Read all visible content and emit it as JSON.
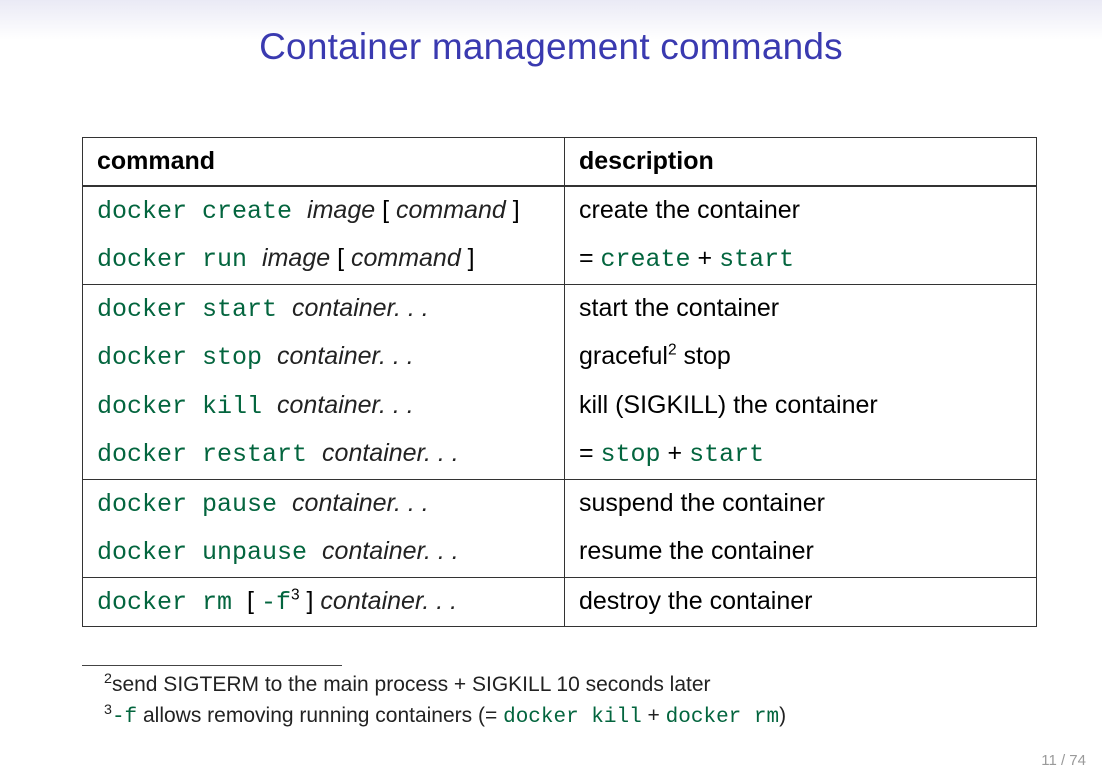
{
  "title": "Container management commands",
  "headers": {
    "col1": "command",
    "col2": "description"
  },
  "rows": [
    {
      "cmd": {
        "tt": "docker create ",
        "it": "image",
        "extra": " [ ",
        "it2": "command",
        "extra2": " ]"
      },
      "desc": {
        "plain": "create the container"
      },
      "topBorder": true,
      "botBorder": false
    },
    {
      "cmd": {
        "tt": "docker run ",
        "it": "image",
        "extra": " [ ",
        "it2": "command",
        "extra2": " ]"
      },
      "desc": {
        "eq": "=",
        "tt1": "create",
        "plus": "+",
        "tt2": "start"
      },
      "topBorder": false,
      "botBorder": true
    },
    {
      "cmd": {
        "tt": "docker start ",
        "it": "container. . ."
      },
      "desc": {
        "plain": "start the container"
      },
      "topBorder": true,
      "botBorder": false
    },
    {
      "cmd": {
        "tt": "docker stop ",
        "it": "container. . ."
      },
      "desc": {
        "plainPre": "graceful",
        "sup": "2",
        "plainPost": " stop"
      },
      "topBorder": false,
      "botBorder": false
    },
    {
      "cmd": {
        "tt": "docker kill ",
        "it": "container. . ."
      },
      "desc": {
        "plain": "kill (SIGKILL) the container"
      },
      "topBorder": false,
      "botBorder": false
    },
    {
      "cmd": {
        "tt": "docker restart ",
        "it": "container. . ."
      },
      "desc": {
        "eq": "=",
        "tt1": "stop",
        "plus": "+",
        "tt2": "start"
      },
      "topBorder": false,
      "botBorder": true
    },
    {
      "cmd": {
        "tt": "docker pause ",
        "it": "container. . ."
      },
      "desc": {
        "plain": "suspend the container"
      },
      "topBorder": true,
      "botBorder": false
    },
    {
      "cmd": {
        "tt": "docker unpause ",
        "it": "container. . ."
      },
      "desc": {
        "plain": "resume the container"
      },
      "topBorder": false,
      "botBorder": true
    },
    {
      "cmd": {
        "tt": "docker rm ",
        "extra": "[ ",
        "ttflag": "-f",
        "sup": "3",
        "extra2": " ] ",
        "it": "container. . ."
      },
      "desc": {
        "plain": "destroy the container"
      },
      "topBorder": true,
      "botBorder": true
    }
  ],
  "footnotes": [
    {
      "num": "2",
      "text": "send SIGTERM to the main process + SIGKILL 10 seconds later"
    },
    {
      "num": "3",
      "ttflag": "-f",
      "text1": " allows removing running containers (= ",
      "tt1": "docker kill",
      "plus": " + ",
      "tt2": "docker rm",
      "text2": ")"
    }
  ],
  "page": "11 / 74"
}
